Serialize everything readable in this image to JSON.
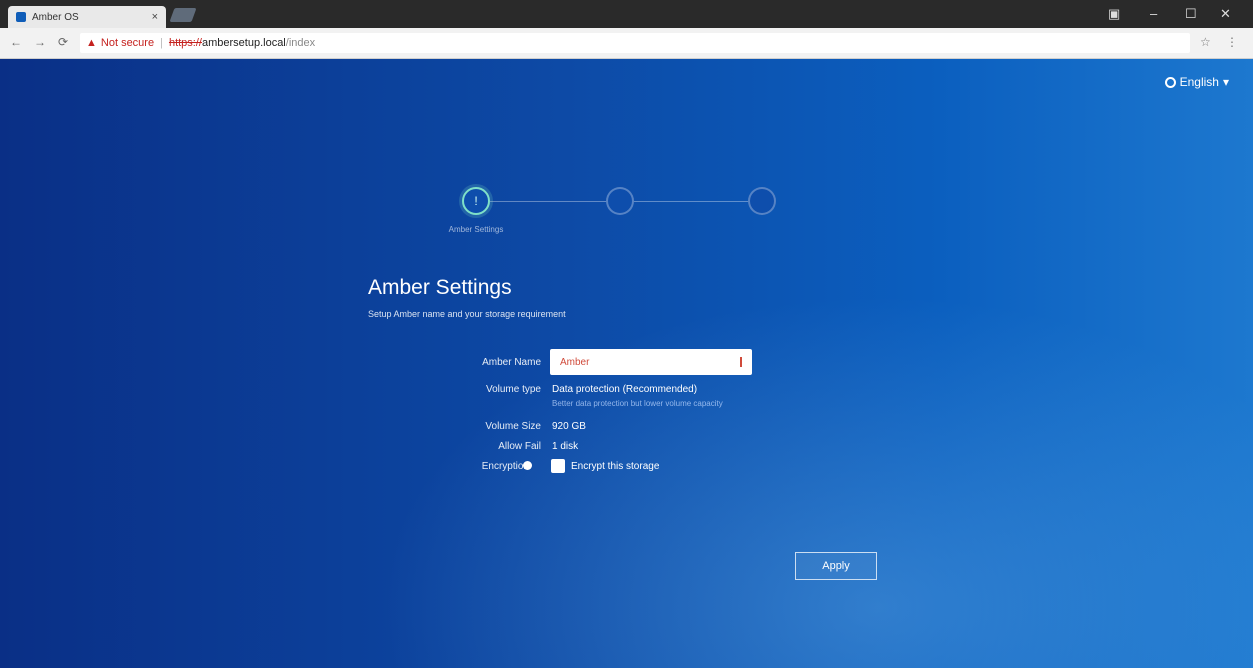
{
  "browser": {
    "tab_title": "Amber OS",
    "tab_close": "×",
    "window_controls": [
      "▣",
      "–",
      "☐",
      "✕"
    ],
    "nav": {
      "back": "←",
      "forward": "→",
      "reload": "⟳"
    },
    "address": {
      "security_icon": "warning-triangle",
      "security_label": "Not secure",
      "separator": "|",
      "scheme": "https://",
      "host": "ambersetup.local",
      "path": "/index"
    },
    "bookmark_star": "☆",
    "menu": "⋮"
  },
  "language": {
    "label": "English",
    "caret": "▾"
  },
  "stepper": {
    "steps": [
      {
        "label": "Amber Settings",
        "icon": "!"
      },
      {
        "label": "",
        "icon": ""
      },
      {
        "label": "",
        "icon": ""
      }
    ],
    "active_index": 0
  },
  "form": {
    "title": "Amber Settings",
    "subtitle": "Setup Amber name and your storage requirement",
    "amber_name_label": "Amber Name",
    "amber_name_value": "Amber",
    "volume_type_label": "Volume type",
    "volume_type_value": "Data protection (Recommended)",
    "volume_type_hint": "Better data protection but lower volume capacity",
    "volume_size_label": "Volume Size",
    "volume_size_value": "920 GB",
    "allow_fail_label": "Allow Fail",
    "allow_fail_value": "1 disk",
    "encryption_label": "Encryption",
    "encryption_checkbox_label": "Encrypt this storage",
    "apply_label": "Apply"
  },
  "colors": {
    "background_start": "#0a2f86",
    "background_end": "#1d78cf",
    "active_step": "#7fe0c8",
    "input_text": "#d04a3a"
  }
}
